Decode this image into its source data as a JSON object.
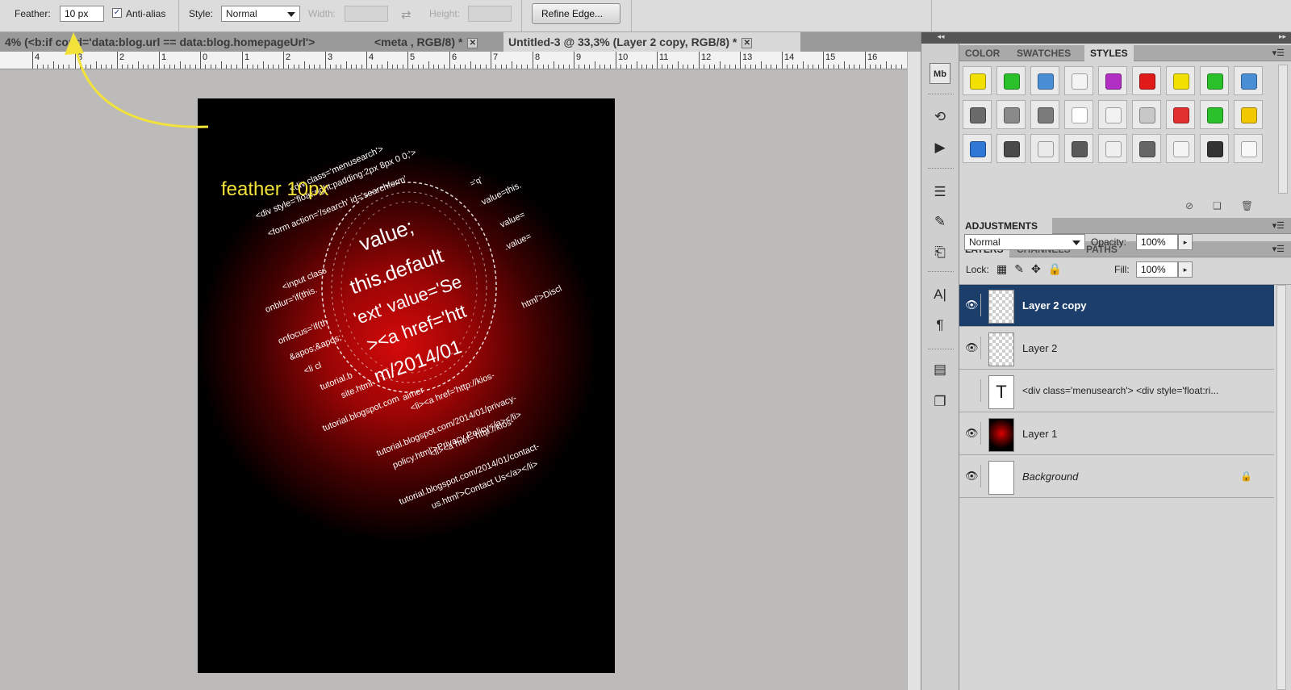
{
  "options": {
    "feather_label": "Feather:",
    "feather_value": "10 px",
    "antialias_label": "Anti-alias",
    "antialias_checked": true,
    "style_label": "Style:",
    "style_value": "Normal",
    "width_label": "Width:",
    "height_label": "Height:",
    "refine_edge_label": "Refine Edge..."
  },
  "tabs": [
    {
      "label": "4% (<b:if cond='data:blog.url == data:blog.homepageUrl'>"
    },
    {
      "label": "<meta , RGB/8) *"
    },
    {
      "label": "Untitled-3 @ 33,3% (Layer 2 copy, RGB/8) *"
    }
  ],
  "ruler_numbers": [
    "4",
    "3",
    "2",
    "1",
    "0",
    "1",
    "2",
    "3",
    "4",
    "5",
    "6",
    "7",
    "8",
    "9",
    "10",
    "11",
    "12",
    "13",
    "14",
    "15",
    "16"
  ],
  "annotation": {
    "text": "feather 10px",
    "color": "#f2e23a"
  },
  "document_text": [
    "<div class='menusearch'>",
    "<div style='float:right;padding:2px 8px 0 0;'>",
    "<form action='/search' id='searchform'",
    "<input class",
    "onblur='if(this.",
    "onfocus='if(th",
    "&apos;&apos;",
    "<li cl",
    "tutorial.b",
    "site.html",
    "tutorial.blogspot.com",
    "<li><a href='http://kios-",
    "tutorial.blogspot.com/2014/01/privacy-",
    "policy.html'>Privacy Policy</a></li>",
    "<li><a href='http://kios-",
    "tutorial.blogspot.com/2014/01/contact-",
    "us.html'>Contact Us</a></li>",
    "value;",
    "this.default",
    "'ext' value='Se",
    "><a href='htt",
    "m/2014/01",
    "value=this.",
    "value=",
    ".value=",
    "html'>Discl",
    "aimer",
    "='q'"
  ],
  "tools": [
    {
      "icon": "mini-bridge-icon",
      "glyph": "Mb"
    },
    {
      "icon": "history-icon",
      "glyph": "⟲"
    },
    {
      "icon": "actions-icon",
      "glyph": "▶"
    },
    {
      "icon": "adjustments-icon",
      "glyph": "☰"
    },
    {
      "icon": "brush-presets-icon",
      "glyph": "✎"
    },
    {
      "icon": "clone-source-icon",
      "glyph": "⎗"
    },
    {
      "icon": "character-icon",
      "glyph": "A|"
    },
    {
      "icon": "paragraph-icon",
      "glyph": "¶"
    },
    {
      "icon": "notes-icon",
      "glyph": "▤"
    },
    {
      "icon": "layer-comps-icon",
      "glyph": "❐"
    }
  ],
  "styles_panel": {
    "tabs": [
      "COLOR",
      "SWATCHES",
      "STYLES"
    ],
    "active_tab": "STYLES",
    "swatch_colors": [
      [
        "#f2e000",
        "#2bc12b",
        "#4a8fd6",
        "#f4f4f4",
        "#b22fc4",
        "#e01919",
        "#f2e000",
        "#2bc12b",
        "#4a8fd6"
      ],
      [
        "#6a6a6a",
        "#8a8a8a",
        "#7a7a7a",
        "#ffffff",
        "#f2f2f2",
        "#c8c8c8",
        "#e03030",
        "#2bc12b",
        "#f2c800"
      ],
      [
        "#2f78d6",
        "#4a4a4a",
        "#eaeaea",
        "#5a5a5a",
        "#f0f0f0",
        "#666666",
        "#f4f4f4",
        "#333333",
        "#f8f8f8"
      ]
    ]
  },
  "adjustments_panel": {
    "title": "ADJUSTMENTS"
  },
  "layers_panel": {
    "tabs": [
      "LAYERS",
      "CHANNELS",
      "PATHS"
    ],
    "active_tab": "LAYERS",
    "blend_mode": "Normal",
    "opacity_label": "Opacity:",
    "opacity_value": "100%",
    "lock_label": "Lock:",
    "fill_label": "Fill:",
    "fill_value": "100%",
    "layers": [
      {
        "name": "Layer 2 copy",
        "thumb": "transparent",
        "visible": true,
        "selected": true
      },
      {
        "name": "Layer 2",
        "thumb": "transparent",
        "visible": true,
        "selected": false
      },
      {
        "name": "<div class='menusearch'> <div style='float:ri...",
        "thumb": "text",
        "thumb_glyph": "T",
        "visible": false,
        "selected": false
      },
      {
        "name": "Layer 1",
        "thumb": "red-glow",
        "visible": true,
        "selected": false
      },
      {
        "name": "Background",
        "thumb": "white",
        "visible": true,
        "selected": false,
        "locked": true
      }
    ]
  }
}
